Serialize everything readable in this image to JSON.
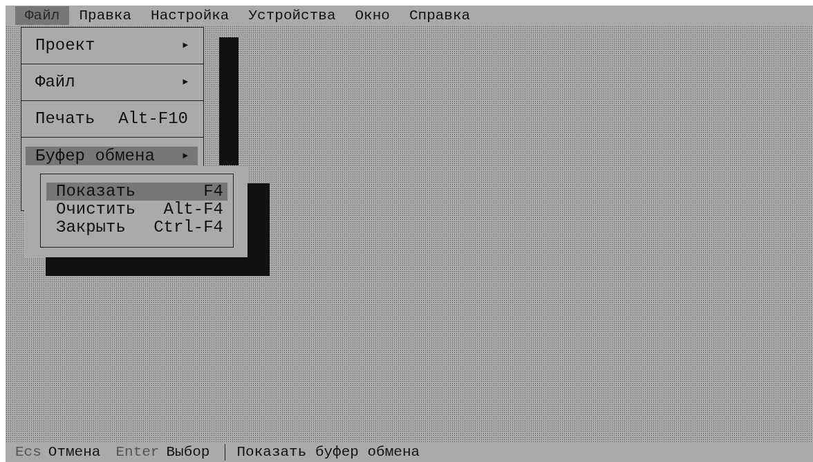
{
  "menubar": [
    {
      "label": "Файл",
      "selected": true
    },
    {
      "label": "Правка",
      "selected": false
    },
    {
      "label": "Настройка",
      "selected": false
    },
    {
      "label": "Устройства",
      "selected": false
    },
    {
      "label": "Окно",
      "selected": false
    },
    {
      "label": "Справка",
      "selected": false
    }
  ],
  "menu": {
    "items": [
      {
        "kind": "submenu",
        "label": "Проект",
        "arrow": "►",
        "selected": false
      },
      {
        "kind": "submenu",
        "label": "Файл",
        "arrow": "►",
        "selected": false
      },
      {
        "kind": "command",
        "label": "Печать",
        "shortcut": "Alt-F10",
        "selected": false
      },
      {
        "kind": "submenu",
        "label": "Буфер обмена",
        "arrow": "►",
        "selected": true
      }
    ]
  },
  "submenu": {
    "items": [
      {
        "label": "Показать",
        "shortcut": "F4",
        "selected": true
      },
      {
        "label": "Очистить",
        "shortcut": "Alt-F4",
        "selected": false
      },
      {
        "label": "Закрыть",
        "shortcut": "Ctrl-F4",
        "selected": false
      }
    ]
  },
  "status_bar": {
    "hints": [
      {
        "key": "Ecs",
        "label": "Отмена"
      },
      {
        "key": "Enter",
        "label": "Выбор"
      }
    ],
    "message": "Показать буфер обмена"
  }
}
